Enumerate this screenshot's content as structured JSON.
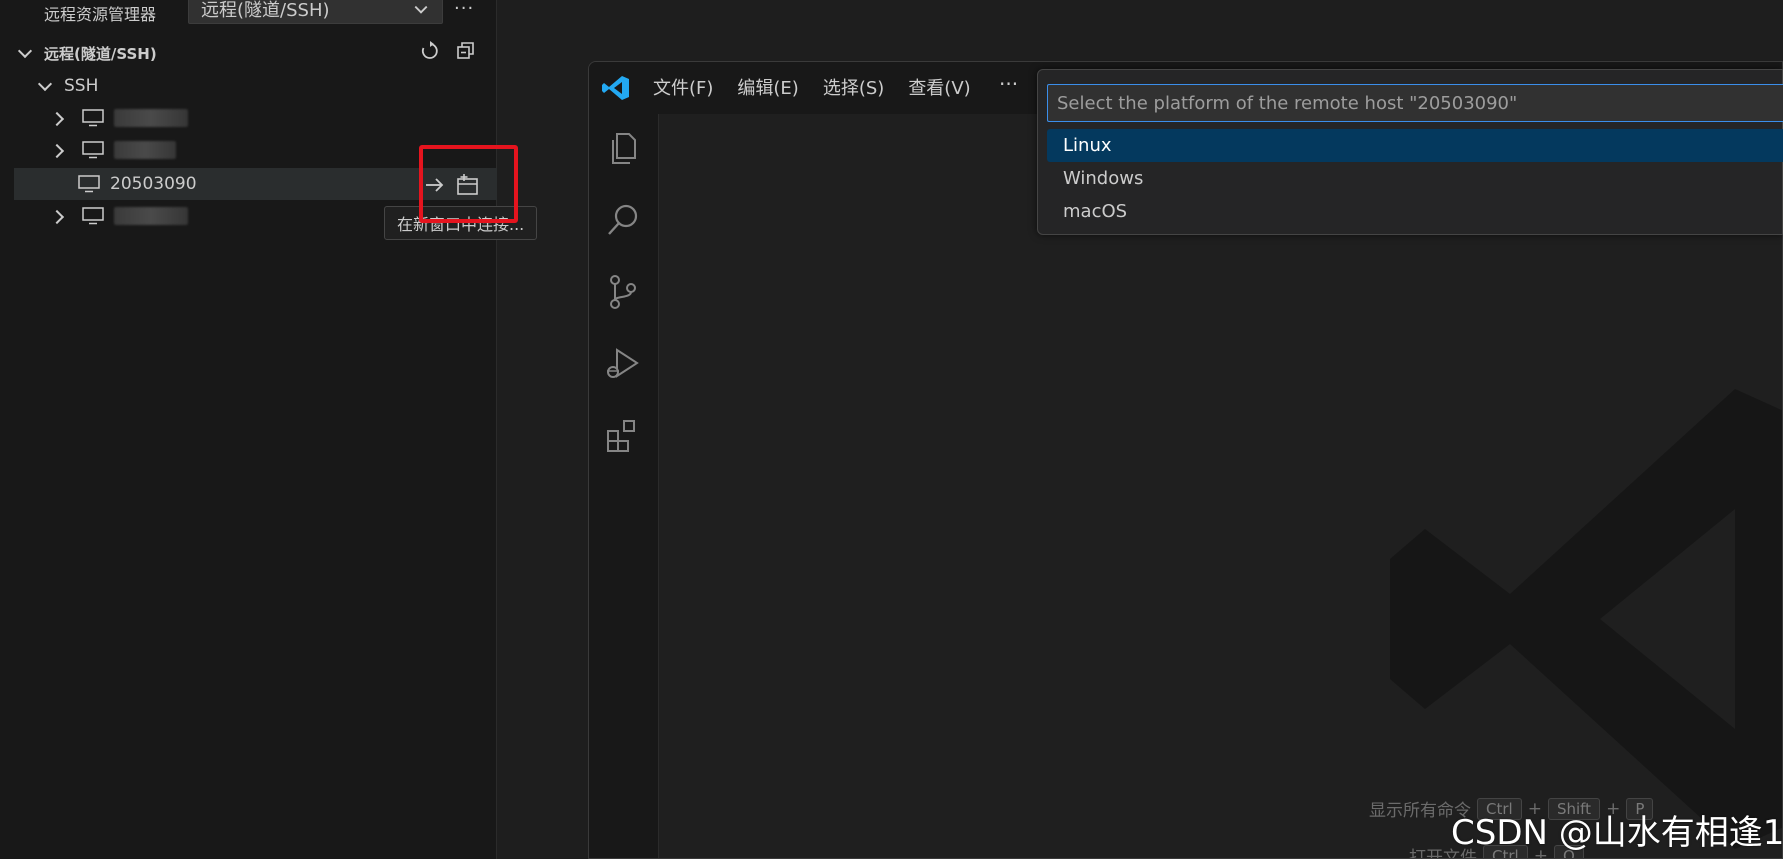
{
  "left": {
    "title": "远程资源管理器",
    "select_value": "远程(隧道/SSH)",
    "more": "···",
    "section_title": "远程(隧道/SSH)",
    "ssh_label": "SSH",
    "hosts": [
      {
        "label": "",
        "blurred": true
      },
      {
        "label": "",
        "blurred": true
      },
      {
        "label": "20503090",
        "blurred": false
      },
      {
        "label": "",
        "blurred": true
      }
    ],
    "tooltip": "在新窗口中连接..."
  },
  "window": {
    "menus": [
      "文件(F)",
      "编辑(E)",
      "选择(S)",
      "查看(V)"
    ],
    "menu_more": "···",
    "quick_pick": {
      "placeholder": "Select the platform of the remote host \"20503090\"",
      "items": [
        "Linux",
        "Windows",
        "macOS"
      ],
      "active_index": 0
    },
    "shortcuts": {
      "show_all_label": "显示所有命令",
      "keys": [
        "Ctrl",
        "+",
        "Shift",
        "+",
        "P"
      ],
      "open_file_label": "打开文件",
      "open_keys": [
        "Ctrl",
        "+",
        "O"
      ]
    }
  },
  "watermark": "CSDN @山水有相逢1",
  "colors": {
    "accent_blue": "#3b8eea",
    "selection": "#04395e",
    "highlight_box": "#e5141e",
    "vscode_blue": "#23a9f2"
  }
}
